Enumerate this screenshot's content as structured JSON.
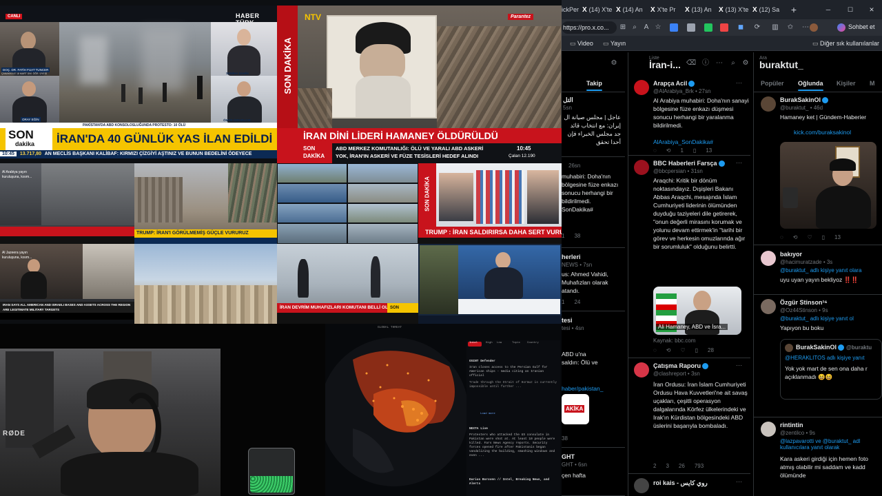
{
  "tv": {
    "canli": "CANLI",
    "haberturk_logo": "HABER TÜRK",
    "guest1_name": "DOÇ. DR. FATİH FUAT TUNCER",
    "guest1_title": "ÇANAKKALE 18 MART ÜNİ. ÖĞR. ÜYESİ",
    "guest2_name": "SEMİHA ŞAHİN",
    "guest3_name": "ORAY EĞİN",
    "guest3_title": "HABERTÜRK YAZARI",
    "guest4_name": "ÖMER ÖZKIZILCIK",
    "guest4_title": "SİYASET ANALİSTİ",
    "strap1": "PAKİSTAN'DA ABD KONSOLOSLUĞUNDA PROTESTO: 10 ÖLÜ",
    "son_label": "SON",
    "dakika_label": "dakika",
    "headline1": "İRAN'DA 40 GÜNLÜK YAS İLAN EDİLDİ",
    "ticker1_time": "10:45",
    "ticker1_index": "13.717,80",
    "ticker1": "AN MECLİS BAŞKANI KALİBAF: KIRMIZI ÇİZGİYİ AŞTINIZ VE BUNUN BEDELİNİ ÖDEYECE",
    "ntv_logo": "NTV",
    "son_dakika_vertical": "SON DAKİKA",
    "parantez": "Parantez",
    "headline2": "İRAN DİNİ LİDERİ HAMANEY ÖLDÜRÜLDÜ",
    "ntv_son": "SON",
    "ntv_dakika": "DAKİKA",
    "ntv_sub1": "ABD MERKEZ KOMUTANLIĞI: ÖLÜ VE YARALI ABD ASKERİ",
    "ntv_sub2": "YOK, İRAN'IN ASKERİ VE FÜZE TESİSLERİ HEDEF ALINDI",
    "ntv_time": "10:45",
    "ntv_index": "Çalan 12.190",
    "alarabiya_caption": "Al Arabiya yayın kuruluşuna, kısım...",
    "strap_trump1": "TRUMP: İRAN'I GÖRÜLMEMİŞ GÜÇLE VURURUZ",
    "strap_trump2": "TRUMP : İRAN SALDIRIRSA DAHA SERT VURURUZ",
    "son_dakika_small": "SON DAKİKA",
    "aljazeera_caption": "Al Jazeera yayın kuruluşuna, kısım...",
    "aljazeera_strap": "IRAN SAYS ALL AMERICAN AND ISRAELI BASES AND ASSETS ACROSS THE REGION ARE LEGITIMATE MILITARY TARGETS",
    "strap_devrim": "İRAN DEVRİM MUHAFIZLARI KOMUTANI BELLİ OLDU",
    "son_dakika_corner": "SON DAKİKA"
  },
  "map_panel": {
    "title": "GLOBAL THREAT",
    "tabs": [
      "Intel",
      "High",
      "Low",
      "Topic",
      "Country"
    ],
    "items": [
      {
        "source": "OSINT Defender",
        "text": "Iran closes access to the Persian Gulf for American ships - media citing an Iranian official",
        "sub": "Trade through the Strait of Hormuz is currently impossible until further ..."
      },
      {
        "source": "NEXTA Live",
        "text": "Protesters who attacked the US consulate in Pakistan were shot at. At least 10 people were killed. Fars News Agency reports. Security forces opened fire after Pakistanis began vandalizing the building, smashing windows and even ..."
      },
      {
        "source": "Darius Boroven // Intel, Breaking News, and Alerts",
        "text": ""
      }
    ],
    "load_more": "Load more"
  },
  "webcam": {
    "mic_brand": "RØDE"
  },
  "browser": {
    "tabs": [
      {
        "icon": "X",
        "label": "ickPer"
      },
      {
        "icon": "X",
        "label": "(14) X'te"
      },
      {
        "icon": "X",
        "label": "(14) An"
      },
      {
        "icon": "X",
        "label": "X'te Pr"
      },
      {
        "icon": "X",
        "label": "(13) An"
      },
      {
        "icon": "X",
        "label": "(13) X'te"
      },
      {
        "icon": "X",
        "label": "(12) Sa"
      }
    ],
    "new_tab": "+",
    "address": "https://pro.x.co...",
    "chat_label": "Sohbet et",
    "bookmarks": [
      "Video",
      "Yayın"
    ],
    "other_bookmarks": "Diğer sık kullanılanlar"
  },
  "col0": {
    "tab": "Takip",
    "post1_name": "التل",
    "post1_handle": "5sn",
    "post1_text": "عاجل | مجلس صيانة ال إيران: مع انتخاب قائد جد مجلس الخبراء فإن أحدا تحقق",
    "post2_handle": "26sn",
    "post2_text": "muhabiri: Doha'nın bölgesine füze enkazı sonucu herhangi bir bildirilmedi. SonDakika#",
    "post2_stats": [
      "1",
      "38"
    ],
    "post3_name": "herleri",
    "post3_handle": "NEWS • 7sn",
    "post3_text": "us: Ahmed Vahidi, Muhafızları olarak atandı.",
    "post3_stats": [
      "1",
      "24"
    ],
    "post4_name": "tesi",
    "post4_handle": "tesi • 4sn",
    "post4_text": "ABD u'na saldırı: Ölü ve",
    "post4_link": "haber/pakistan_",
    "post4_stats": [
      "38"
    ],
    "post5_name": "GHT",
    "post5_handle": "GHT • 6sn",
    "post5_text": "çen hafta",
    "post_label_dakika": "AKİKA"
  },
  "col1": {
    "subtitle": "Liste",
    "title": "İran-i...",
    "posts": [
      {
        "name": "Arapça Acil",
        "handle": "@AlArabiya_Brk • 27sn",
        "text": "Al Arabiya muhabiri: Doha'nın sanayi bölgesine füze enkazı düşmesi sonucu herhangi bir yaralanma bildirilmedi.",
        "link": "AlArabiya_SonDakika#",
        "stats": [
          "",
          "",
          "1",
          "",
          "13"
        ]
      },
      {
        "name": "BBC Haberleri Farsça",
        "handle": "@bbcpersian • 31sn",
        "text": "Araqchi: Kritik bir dönüm noktasındayız. Dışişleri Bakanı Abbas Araqchi, mesajında İslam Cumhuriyeti liderinin ölümünden duyduğu taziyeleri dile getirerek, \"onun değerli mirasını korumak ve yolunu devam ettirmek'in \"tarihi bir görev ve herkesin omuzlarında ağır bir sorumluluk\" olduğunu belirtti.",
        "card_caption": "Ali Hamaney, ABD ve İsra...",
        "card_source": "Kaynak: bbc.com",
        "stats": [
          "",
          "",
          "",
          "",
          "28"
        ]
      },
      {
        "name": "Çatışma Raporu",
        "handle": "@clashreport • 3sn",
        "text": "İran Ordusu: İran İslam Cumhuriyeti Ordusu Hava Kuvvetleri'ne ait savaş uçakları, çeşitli operasyon dalgalarında Körfez ülkelerindeki ve Irak'ın Kürdistan bölgesindeki ABD üslerini başarıyla bombaladı.",
        "stats": [
          "2",
          "3",
          "26",
          "793",
          ""
        ]
      },
      {
        "name": "roi kais - روي كايس",
        "handle": "",
        "text": ""
      }
    ]
  },
  "col2": {
    "subtitle": "Ara",
    "title": "buraktut_",
    "tabs": [
      "Popüler",
      "Oğlunda",
      "Kişiler",
      "M"
    ],
    "posts": [
      {
        "name": "BurakSakinOl",
        "handle": "@buraktut_ • 46d",
        "text": "Hamaney ket | Gündem-Haberier",
        "link": "kick.com/buraksakinol",
        "stats": [
          "",
          "",
          "",
          "13"
        ]
      },
      {
        "name": "bakıyor",
        "handle": "@hacimuratzade • 3s",
        "reply": "@buraktut_ adlı kişiye yanıt olara",
        "text": "uyu uyan yayın bekliyoz ‼️‼️"
      },
      {
        "name": "Özgür Stinson¹⁶",
        "handle": "@Oz44Stinson • 9s",
        "reply": "@buraktut_ adlı kişiye yanıt ol",
        "text": "Yapıyon bu boku",
        "quote_name": "BurakSakinOl",
        "quote_handle": "@buraktu",
        "quote_reply": "@HERAKLITOS adlı kişiye yanıt",
        "quote_text": "Yok yok mart de sen ona daha r açıklanmadı 😆😆"
      },
      {
        "name": "rintintin",
        "handle": "@zentilco • 9s",
        "reply": "@lazpavarotti ve @buraktut_ adl kullanıcılara yanıt olarak",
        "text": "Kara askeri girdiği için hemen foto atmış olabilir mi saddam ve kadd ölümünde"
      }
    ]
  },
  "colors": {
    "accent": "#1d9bf0",
    "breaking_red": "#d0121b",
    "haberturk_yellow": "#f5c400"
  }
}
